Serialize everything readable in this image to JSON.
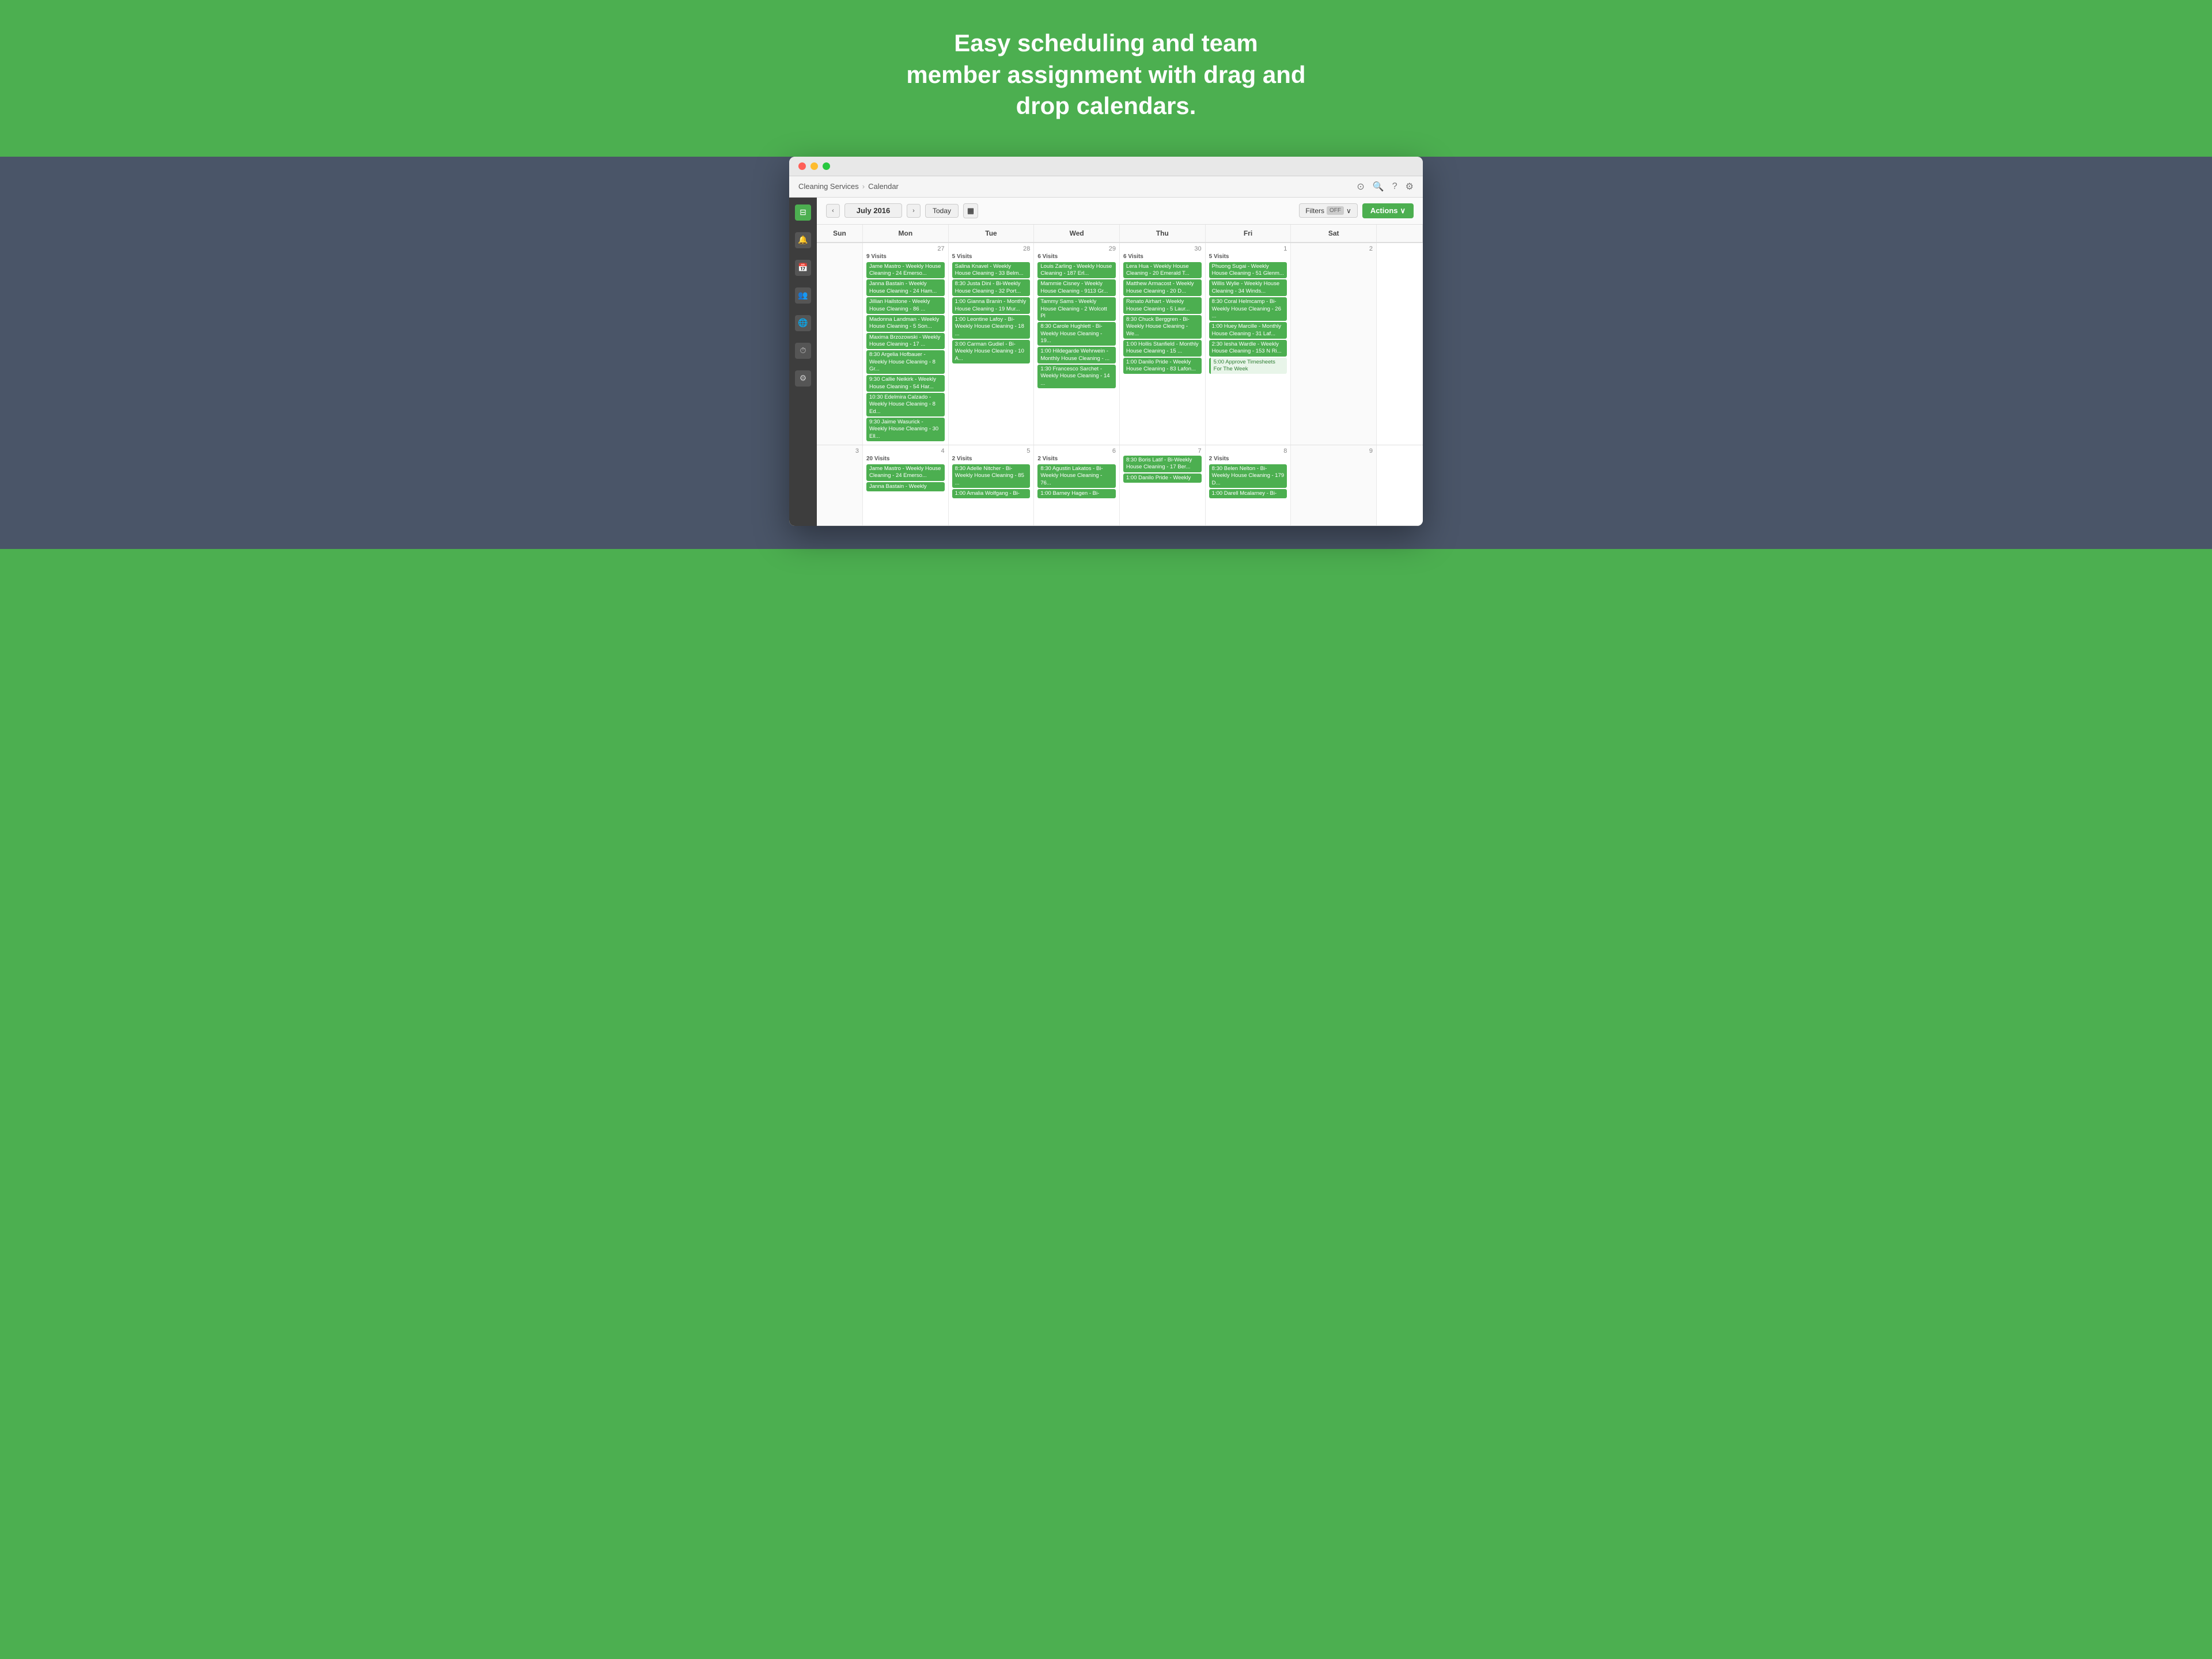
{
  "hero": {
    "title": "Easy scheduling and team member assignment with drag and drop calendars."
  },
  "titleBar": {
    "lights": [
      "red",
      "yellow",
      "green"
    ]
  },
  "navBar": {
    "breadcrumb": [
      "Cleaning Services",
      "Calendar"
    ],
    "icons": [
      "circle-icon",
      "search-icon",
      "question-icon",
      "gear-icon"
    ]
  },
  "sidebar": {
    "icons": [
      {
        "name": "dashboard-icon",
        "active": true,
        "symbol": "⊟"
      },
      {
        "name": "bell-icon",
        "active": false,
        "symbol": "🔔"
      },
      {
        "name": "calendar-icon",
        "active": false,
        "symbol": "📅"
      },
      {
        "name": "people-icon",
        "active": false,
        "symbol": "👥"
      },
      {
        "name": "globe-icon",
        "active": false,
        "symbol": "🌐"
      },
      {
        "name": "clock-icon",
        "active": false,
        "symbol": "⏱"
      },
      {
        "name": "settings-icon",
        "active": false,
        "symbol": "⚙"
      }
    ]
  },
  "calToolbar": {
    "prevLabel": "‹",
    "nextLabel": "›",
    "monthLabel": "July 2016",
    "todayLabel": "Today",
    "gridLabel": "▦",
    "filtersLabel": "Filters",
    "filtersState": "OFF",
    "filtersChevron": "∨",
    "actionsLabel": "Actions",
    "actionsChevron": "∨"
  },
  "calHeaders": [
    "Sun",
    "Mon",
    "Tue",
    "Wed",
    "Thu",
    "Fri",
    "Sat"
  ],
  "week1": {
    "days": [
      {
        "number": "",
        "outside": true,
        "visitCount": "",
        "events": []
      },
      {
        "number": "27",
        "outside": false,
        "visitCount": "9 Visits",
        "events": [
          {
            "text": "Jame Mastro - Weekly House Cleaning - 24 Emerso...",
            "type": "green"
          },
          {
            "text": "Janna Bastain - Weekly House Cleaning - 24 Ham...",
            "type": "green"
          },
          {
            "text": "Jillian Hailstone - Weekly House Cleaning - 86 ...",
            "type": "green"
          },
          {
            "text": "Madonna Landman - Weekly House Cleaning - 5 Son...",
            "type": "green"
          },
          {
            "text": "Maxima Brzozowski - Weekly House Cleaning - 17 ...",
            "type": "green"
          },
          {
            "text": "8:30 Argelia Hofbauer - Weekly House Cleaning - 8 Gr...",
            "type": "green"
          },
          {
            "text": "9:30 Callie Neikirk - Weekly House Cleaning - 54 Har...",
            "type": "green"
          },
          {
            "text": "10:30 Edelmira Calzado - Weekly House Cleaning - 8 Ed...",
            "type": "green"
          },
          {
            "text": "9:30 Jaime Wasurick - Weekly House Cleaning - 30 Ell...",
            "type": "green"
          }
        ]
      },
      {
        "number": "28",
        "outside": false,
        "visitCount": "5 Visits",
        "events": [
          {
            "text": "Salina Knavel - Weekly House Cleaning - 33 Belm...",
            "type": "green"
          },
          {
            "text": "8:30 Justa Dini - Bi-Weekly House Cleaning - 32 Port...",
            "type": "green"
          },
          {
            "text": "1:00 Gianna Branin - Monthly House Cleaning - 19 Mur...",
            "type": "green"
          },
          {
            "text": "1:00 Leontine Lafoy - Bi-Weekly House Cleaning - 18 ...",
            "type": "green"
          },
          {
            "text": "3:00 Carman Gudiel - Bi-Weekly House Cleaning - 10 A...",
            "type": "green"
          }
        ]
      },
      {
        "number": "29",
        "outside": false,
        "visitCount": "6 Visits",
        "events": [
          {
            "text": "Louis Zarling - Weekly House Cleaning - 187 Erl...",
            "type": "green"
          },
          {
            "text": "Mammie Cisney - Weekly House Cleaning - 9113 Gr...",
            "type": "green"
          },
          {
            "text": "Tammy Sams - Weekly House Cleaning - 2 Wolcott Pl",
            "type": "green"
          },
          {
            "text": "8:30 Carole Hughlett - Bi-Weekly House Cleaning - 19...",
            "type": "green"
          },
          {
            "text": "1:00 Hildegarde Wehrwein - Monthly House Cleaning - ...",
            "type": "green"
          },
          {
            "text": "1:30 Francesco Sarchet - Weekly House Cleaning - 14 ...",
            "type": "green"
          }
        ]
      },
      {
        "number": "30",
        "outside": false,
        "visitCount": "6 Visits",
        "events": [
          {
            "text": "Lera Hua - Weekly House Cleaning - 20 Emerald T...",
            "type": "green"
          },
          {
            "text": "Matthew Armacost - Weekly House Cleaning - 20 D...",
            "type": "green"
          },
          {
            "text": "Renato Airhart - Weekly House Cleaning - 5 Laur...",
            "type": "green"
          },
          {
            "text": "8:30 Chuck Berggren - Bi-Weekly House Cleaning - We...",
            "type": "green"
          },
          {
            "text": "1:00 Hollis Stanfield - Monthly House Cleaning - 15 ...",
            "type": "green"
          },
          {
            "text": "1:00 Danilo Pride - Weekly House Cleaning - 83 Lafon...",
            "type": "green"
          }
        ]
      },
      {
        "number": "1",
        "outside": false,
        "visitCount": "5 Visits",
        "events": [
          {
            "text": "Phuong Sugai - Weekly House Cleaning - 51 Glenm...",
            "type": "green"
          },
          {
            "text": "Willis Wylie - Weekly House Cleaning - 34 Winds...",
            "type": "green"
          },
          {
            "text": "8:30 Coral Helmcamp - Bi-Weekly House Cleaning - 26 ...",
            "type": "green"
          },
          {
            "text": "1:00 Huey Marcille - Monthly House Cleaning - 31 Laf...",
            "type": "green"
          },
          {
            "text": "2:30 Iesha Wardle - Weekly House Cleaning - 153 N Ri...",
            "type": "green"
          },
          {
            "text": "5:00 Approve Timesheets For The Week",
            "type": "special"
          }
        ]
      },
      {
        "number": "2",
        "outside": true,
        "visitCount": "",
        "events": []
      }
    ]
  },
  "week2": {
    "days": [
      {
        "number": "3",
        "outside": true,
        "visitCount": "",
        "events": []
      },
      {
        "number": "4",
        "outside": false,
        "visitCount": "20 Visits",
        "events": [
          {
            "text": "Jame Mastro - Weekly House Cleaning - 24 Emerso...",
            "type": "green"
          },
          {
            "text": "Janna Bastain - Weekly",
            "type": "green"
          }
        ]
      },
      {
        "number": "5",
        "outside": false,
        "visitCount": "2 Visits",
        "events": [
          {
            "text": "8:30 Adelle Nitcher - Bi-Weekly House Cleaning - 85 ...",
            "type": "green"
          },
          {
            "text": "1:00 Amalia Wolfgang - Bi-",
            "type": "green"
          }
        ]
      },
      {
        "number": "6",
        "outside": false,
        "visitCount": "2 Visits",
        "events": [
          {
            "text": "8:30 Agustin Lakatos - Bi-Weekly House Cleaning - 76...",
            "type": "green"
          },
          {
            "text": "1:00 Barney Hagen - Bi-",
            "type": "green"
          }
        ]
      },
      {
        "number": "7",
        "outside": false,
        "visitCount": "",
        "events": [
          {
            "text": "8:30 Boris Latif - Bi-Weekly House Cleaning - 17 Ber...",
            "type": "green"
          },
          {
            "text": "1:00 Danilo Pride - Weekly",
            "type": "green"
          }
        ]
      },
      {
        "number": "8",
        "outside": false,
        "visitCount": "2 Visits",
        "events": [
          {
            "text": "8:30 Belen Nelton - Bi-Weekly House Cleaning - 179 D...",
            "type": "green"
          },
          {
            "text": "1:00 Darell Mcalarney - Bi-",
            "type": "green"
          }
        ]
      },
      {
        "number": "9",
        "outside": true,
        "visitCount": "",
        "events": []
      }
    ]
  }
}
